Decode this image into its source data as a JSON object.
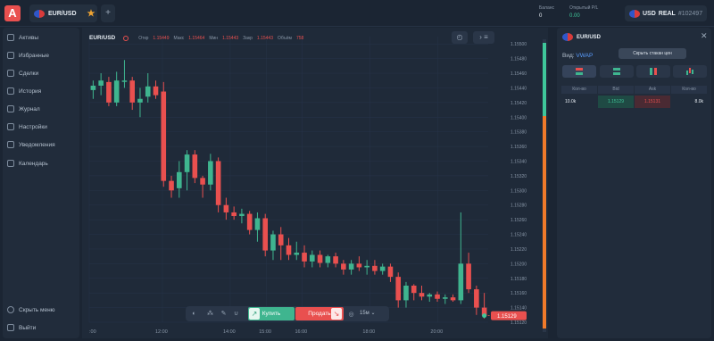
{
  "topbar": {
    "logo_letter": "A",
    "asset_tab": "EUR/USD",
    "add_tab": "+",
    "balance_label": "Баланс",
    "balance_value": "0",
    "pl_label": "Открытый P/L",
    "pl_value": "0.00",
    "account_currency": "USD",
    "account_type": "REAL",
    "account_number": "#102497"
  },
  "sidebar": {
    "items": [
      {
        "label": "Активы",
        "icon": "assets-icon"
      },
      {
        "label": "Избранные",
        "icon": "favorites-icon"
      },
      {
        "label": "Сделки",
        "icon": "trades-icon"
      },
      {
        "label": "История",
        "icon": "history-icon"
      },
      {
        "label": "Журнал",
        "icon": "journal-icon"
      },
      {
        "label": "Настройки",
        "icon": "settings-icon"
      },
      {
        "label": "Уведомления",
        "icon": "notifications-icon"
      },
      {
        "label": "Календарь",
        "icon": "calendar-icon"
      }
    ],
    "hide_menu": "Скрыть меню",
    "logout": "Выйти"
  },
  "chart_header": {
    "pair": "EUR/USD",
    "open_label": "Откр",
    "open_value": "1.15449",
    "high_label": "Макс",
    "high_value": "1.15464",
    "low_label": "Мин",
    "low_value": "1.15443",
    "close_label": "Закр",
    "close_value": "1.15443",
    "volume_label": "Объём",
    "volume_value": "758"
  },
  "trade_bar": {
    "buy_label": "Купить",
    "sell_label": "Продать",
    "timeframe": "15м"
  },
  "colors": {
    "up": "#3fb58f",
    "down": "#e9504f",
    "accent": "#5a9dff",
    "background": "#1b2533"
  },
  "chart_data": {
    "type": "candlestick",
    "y_ticks": [
      "1.15500",
      "1.15480",
      "1.15460",
      "1.15440",
      "1.15420",
      "1.15400",
      "1.15380",
      "1.15360",
      "1.15340",
      "1.15320",
      "1.15300",
      "1.15280",
      "1.15260",
      "1.15240",
      "1.15220",
      "1.15200",
      "1.15180",
      "1.15160",
      "1.15140",
      "1.15120"
    ],
    "x_ticks": [
      ":00",
      "12:00",
      "14:00",
      "15:00",
      "16:00",
      "18:00",
      "20:00"
    ],
    "ylim": [
      1.1512,
      1.1551
    ],
    "current_price": "1.15129",
    "candles": [
      {
        "o": 1.15437,
        "h": 1.1545,
        "l": 1.15425,
        "c": 1.15443
      },
      {
        "o": 1.15443,
        "h": 1.1546,
        "l": 1.1543,
        "c": 1.1545
      },
      {
        "o": 1.15448,
        "h": 1.15455,
        "l": 1.15415,
        "c": 1.1542
      },
      {
        "o": 1.1542,
        "h": 1.15462,
        "l": 1.15415,
        "c": 1.1545
      },
      {
        "o": 1.1545,
        "h": 1.15478,
        "l": 1.1544,
        "c": 1.1545
      },
      {
        "o": 1.1545,
        "h": 1.15455,
        "l": 1.1541,
        "c": 1.1542
      },
      {
        "o": 1.1542,
        "h": 1.1544,
        "l": 1.154,
        "c": 1.15425
      },
      {
        "o": 1.15428,
        "h": 1.1546,
        "l": 1.1542,
        "c": 1.15442
      },
      {
        "o": 1.15442,
        "h": 1.1545,
        "l": 1.15425,
        "c": 1.1543
      },
      {
        "o": 1.15435,
        "h": 1.15448,
        "l": 1.15305,
        "c": 1.15313
      },
      {
        "o": 1.15313,
        "h": 1.1532,
        "l": 1.1529,
        "c": 1.153
      },
      {
        "o": 1.15303,
        "h": 1.1534,
        "l": 1.1529,
        "c": 1.15325
      },
      {
        "o": 1.15325,
        "h": 1.15355,
        "l": 1.153,
        "c": 1.15349
      },
      {
        "o": 1.15349,
        "h": 1.15355,
        "l": 1.1531,
        "c": 1.15317
      },
      {
        "o": 1.15317,
        "h": 1.1532,
        "l": 1.1529,
        "c": 1.15308
      },
      {
        "o": 1.15308,
        "h": 1.1535,
        "l": 1.153,
        "c": 1.1534
      },
      {
        "o": 1.1534,
        "h": 1.15345,
        "l": 1.1527,
        "c": 1.1528
      },
      {
        "o": 1.1528,
        "h": 1.1529,
        "l": 1.1526,
        "c": 1.1527
      },
      {
        "o": 1.1527,
        "h": 1.15278,
        "l": 1.1526,
        "c": 1.15265
      },
      {
        "o": 1.15265,
        "h": 1.15275,
        "l": 1.15255,
        "c": 1.15268
      },
      {
        "o": 1.15268,
        "h": 1.15272,
        "l": 1.1524,
        "c": 1.15246
      },
      {
        "o": 1.15246,
        "h": 1.1527,
        "l": 1.1523,
        "c": 1.15262
      },
      {
        "o": 1.15262,
        "h": 1.15268,
        "l": 1.1521,
        "c": 1.15218
      },
      {
        "o": 1.15218,
        "h": 1.15245,
        "l": 1.15205,
        "c": 1.1524
      },
      {
        "o": 1.1524,
        "h": 1.1525,
        "l": 1.15205,
        "c": 1.15225
      },
      {
        "o": 1.15225,
        "h": 1.15235,
        "l": 1.15205,
        "c": 1.15212
      },
      {
        "o": 1.15212,
        "h": 1.1523,
        "l": 1.15205,
        "c": 1.15215
      },
      {
        "o": 1.15215,
        "h": 1.15225,
        "l": 1.15195,
        "c": 1.15203
      },
      {
        "o": 1.15203,
        "h": 1.15218,
        "l": 1.15195,
        "c": 1.15212
      },
      {
        "o": 1.15212,
        "h": 1.15218,
        "l": 1.15195,
        "c": 1.15201
      },
      {
        "o": 1.15201,
        "h": 1.15212,
        "l": 1.15195,
        "c": 1.1521
      },
      {
        "o": 1.1521,
        "h": 1.15215,
        "l": 1.15195,
        "c": 1.152
      },
      {
        "o": 1.152,
        "h": 1.15205,
        "l": 1.15185,
        "c": 1.15192
      },
      {
        "o": 1.15192,
        "h": 1.15205,
        "l": 1.15185,
        "c": 1.152
      },
      {
        "o": 1.152,
        "h": 1.1521,
        "l": 1.1519,
        "c": 1.15195
      },
      {
        "o": 1.15195,
        "h": 1.15205,
        "l": 1.15185,
        "c": 1.15197
      },
      {
        "o": 1.15197,
        "h": 1.15205,
        "l": 1.15185,
        "c": 1.1519
      },
      {
        "o": 1.1519,
        "h": 1.152,
        "l": 1.15185,
        "c": 1.15196
      },
      {
        "o": 1.15196,
        "h": 1.152,
        "l": 1.15175,
        "c": 1.15182
      },
      {
        "o": 1.15182,
        "h": 1.15188,
        "l": 1.1514,
        "c": 1.1515
      },
      {
        "o": 1.1515,
        "h": 1.15175,
        "l": 1.1514,
        "c": 1.1517
      },
      {
        "o": 1.1517,
        "h": 1.15172,
        "l": 1.1515,
        "c": 1.1516
      },
      {
        "o": 1.1516,
        "h": 1.1517,
        "l": 1.1515,
        "c": 1.15155
      },
      {
        "o": 1.15155,
        "h": 1.1516,
        "l": 1.15148,
        "c": 1.15158
      },
      {
        "o": 1.15158,
        "h": 1.15162,
        "l": 1.15148,
        "c": 1.15152
      },
      {
        "o": 1.15152,
        "h": 1.15158,
        "l": 1.15145,
        "c": 1.15154
      },
      {
        "o": 1.15154,
        "h": 1.15158,
        "l": 1.15148,
        "c": 1.1515
      },
      {
        "o": 1.1515,
        "h": 1.1527,
        "l": 1.15145,
        "c": 1.152
      },
      {
        "o": 1.152,
        "h": 1.15215,
        "l": 1.1516,
        "c": 1.15165
      },
      {
        "o": 1.15165,
        "h": 1.1517,
        "l": 1.1513,
        "c": 1.1514
      },
      {
        "o": 1.1514,
        "h": 1.1516,
        "l": 1.15125,
        "c": 1.15129
      }
    ]
  },
  "order_book": {
    "pair": "EUR/USD",
    "tooltip": "Скрыть стакан цен",
    "view_label": "Вид:",
    "view_value": "VWAP",
    "columns": [
      "Кол-во",
      "Bid",
      "Ask",
      "Кол-во"
    ],
    "row": [
      "10.0k",
      "1.15129",
      "1.15131",
      "8.0k"
    ]
  }
}
